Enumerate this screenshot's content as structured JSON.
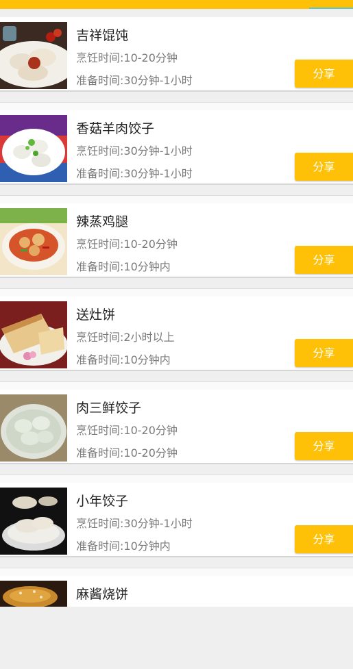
{
  "theme": {
    "accent": "#FFC107",
    "tab_indicator": "#5ec6c0"
  },
  "recipes": [
    {
      "title": "吉祥馄饨",
      "cook": "烹饪时间:10-20分钟",
      "prep": "准备时间:30分钟-1小时",
      "share": "分享"
    },
    {
      "title": "香菇羊肉饺子",
      "cook": "烹饪时间:30分钟-1小时",
      "prep": "准备时间:30分钟-1小时",
      "share": "分享"
    },
    {
      "title": "辣蒸鸡腿",
      "cook": "烹饪时间:10-20分钟",
      "prep": "准备时间:10分钟内",
      "share": "分享"
    },
    {
      "title": "送灶饼",
      "cook": "烹饪时间:2小时以上",
      "prep": "准备时间:10分钟内",
      "share": "分享"
    },
    {
      "title": "肉三鲜饺子",
      "cook": "烹饪时间:10-20分钟",
      "prep": "准备时间:10-20分钟",
      "share": "分享"
    },
    {
      "title": "小年饺子",
      "cook": "烹饪时间:30分钟-1小时",
      "prep": "准备时间:10分钟内",
      "share": "分享"
    },
    {
      "title": "麻酱烧饼"
    }
  ]
}
